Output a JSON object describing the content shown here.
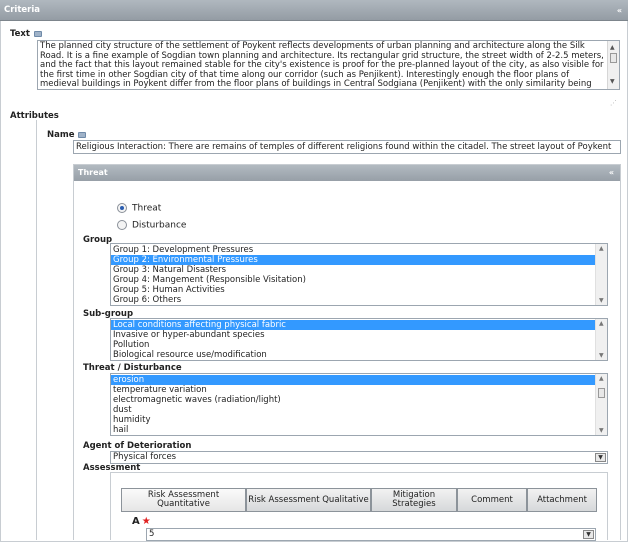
{
  "panel": {
    "title": "Criteria",
    "collapse_icon": "«"
  },
  "text_field": {
    "label": "Text",
    "value": "The planned city structure of the settlement of Poykent reflects developments of urban planning and architecture along the Silk Road. It is a fine example of Sogdian town planning and architecture. Its rectangular grid structure, the street width of 2-2.5 meters, and the fact that this layout remained stable for the city's existence is proof for the pre-planned layout of the city, as also visible for the first time in other Sogdian city of that time along our corridor (such as Penjikent). Interestingly enough the floor plans of medieval buildings in Poykent differ from the floor plans of buildings in Central Sodgiana (Penjikent) with the only similarity being the central hall with four columns decorated with friezes, that are made of clay (while in other places such as Samarcand region of wood). This proves the further development of architectural typologies along the Silk Roads corridor merging with local"
  },
  "attributes": {
    "label": "Attributes",
    "name_label": "Name",
    "name_value": "Religious Interaction: There are remains of temples of different religions found within the citadel. The street layout of Poykent"
  },
  "threat_panel": {
    "title": "Threat",
    "radios": [
      {
        "label": "Threat",
        "checked": true
      },
      {
        "label": "Disturbance",
        "checked": false
      }
    ],
    "group": {
      "label": "Group",
      "options": [
        "Group 1: Development Pressures",
        "Group 2: Environmental Pressures",
        "Group 3: Natural Disasters",
        "Group 4: Mangement (Responsible Visitation)",
        "Group 5: Human Activities",
        "Group 6: Others"
      ],
      "selected_index": 1
    },
    "subgroup": {
      "label": "Sub-group",
      "options": [
        "Local conditions affecting physical fabric",
        "Invasive or hyper-abundant species",
        "Pollution",
        "Biological resource use/modification"
      ],
      "selected_index": 0
    },
    "threat_disturbance": {
      "label": "Threat / Disturbance",
      "options": [
        "erosion",
        "temperature variation",
        "electromagnetic waves (radiation/light)",
        "dust",
        "humidity",
        "hail"
      ],
      "selected_index": 0
    },
    "agent": {
      "label": "Agent of Deterioration",
      "value": "Physical forces"
    },
    "assessment": {
      "label": "Assessment",
      "tabs": [
        "Risk Assessment Quantitative",
        "Risk Assessment Qualitative",
        "Mitigation Strategies",
        "Comment",
        "Attachment"
      ],
      "field_a": {
        "label": "A",
        "required_mark": "★",
        "value": "5"
      }
    }
  },
  "colors": {
    "header_bg": "#a3abb3",
    "selection": "#3399ff",
    "required": "#e02020"
  }
}
